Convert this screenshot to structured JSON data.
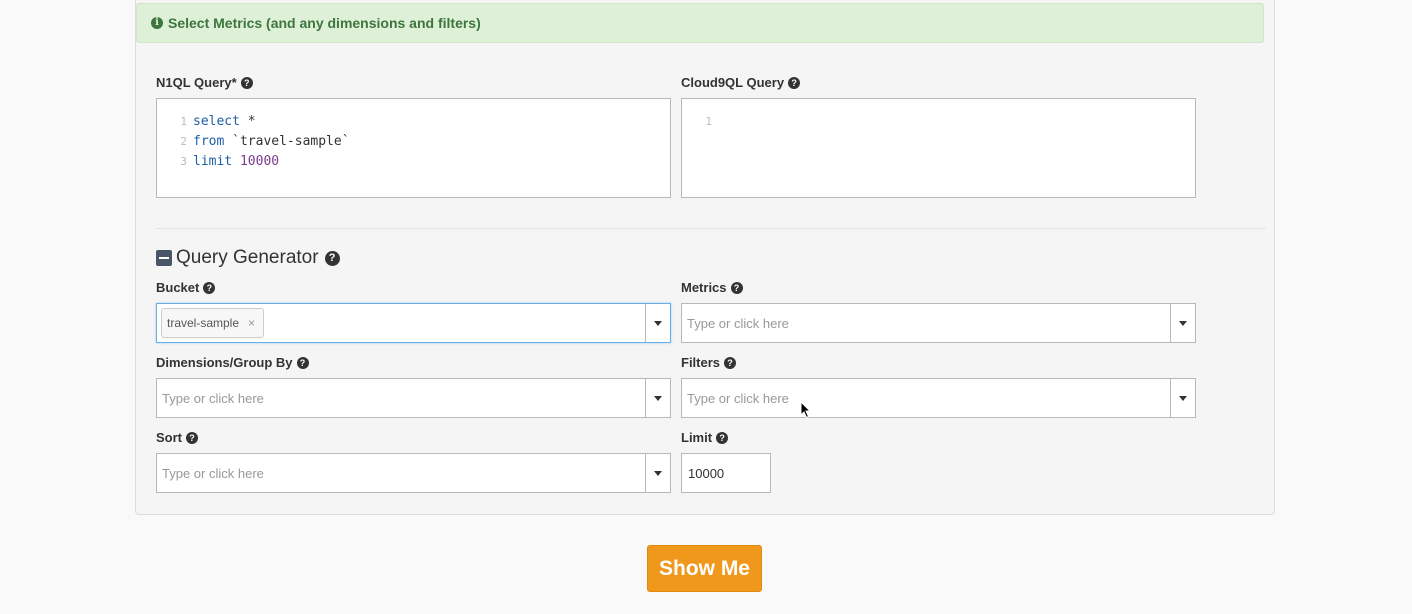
{
  "alert": {
    "text": "Select Metrics (and any dimensions and filters)"
  },
  "n1ql": {
    "label": "N1QL Query*",
    "lines": [
      {
        "num": "1",
        "kw": "select",
        "rest": " *"
      },
      {
        "num": "2",
        "kw": "from",
        "rest": " `travel-sample`"
      },
      {
        "num": "3",
        "kw": "limit",
        "rest": " 10000"
      }
    ]
  },
  "cloud9ql": {
    "label": "Cloud9QL Query",
    "line_num": "1"
  },
  "generator": {
    "title": "Query Generator"
  },
  "bucket": {
    "label": "Bucket",
    "tag": "travel-sample",
    "tag_remove": "×"
  },
  "metrics": {
    "label": "Metrics",
    "placeholder": "Type or click here"
  },
  "dimensions": {
    "label": "Dimensions/Group By",
    "placeholder": "Type or click here"
  },
  "filters": {
    "label": "Filters",
    "placeholder": "Type or click here"
  },
  "sort": {
    "label": "Sort",
    "placeholder": "Type or click here"
  },
  "limit": {
    "label": "Limit",
    "value": "10000"
  },
  "show_button": {
    "label": "Show Me"
  },
  "colors": {
    "accent": "#f0981c",
    "alert_bg": "#dff0d8",
    "alert_text": "#3c763d",
    "keyword": "#1f5fa8",
    "number": "#7b3b8f"
  },
  "icons": {
    "info": "info-circle-icon",
    "help": "question-circle-icon",
    "collapse": "minus-square-icon",
    "dropdown": "caret-down-icon"
  }
}
